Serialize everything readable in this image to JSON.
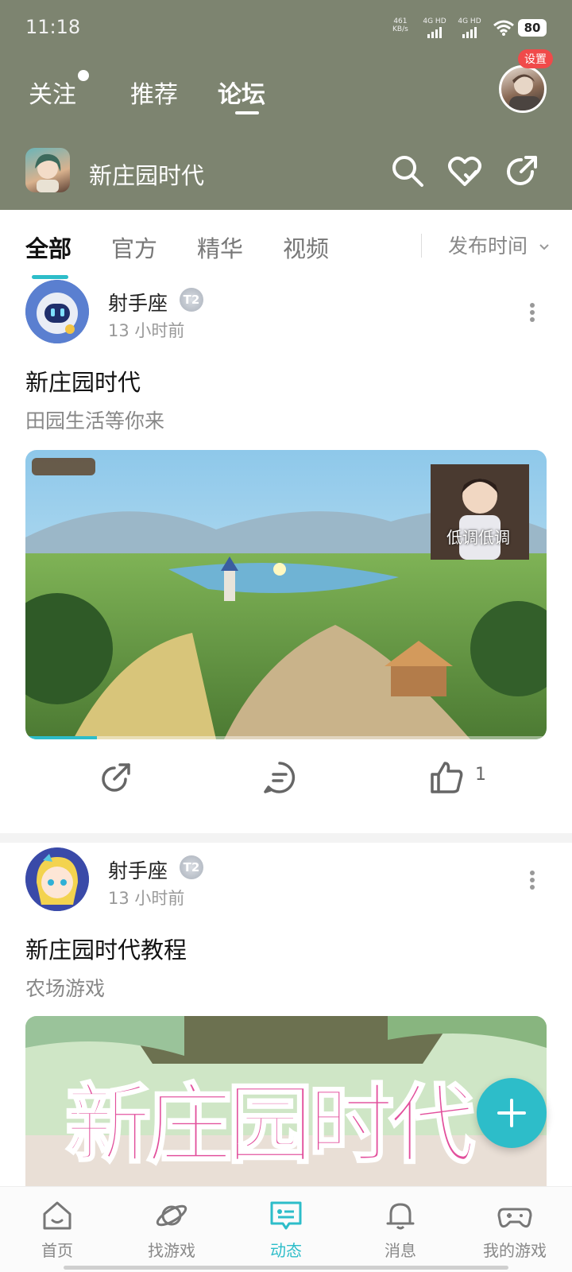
{
  "status_bar": {
    "time": "11:18",
    "net_speed": "461",
    "net_unit": "KB/s",
    "sim1": "4G HD",
    "sim2": "4G HD",
    "battery": "80"
  },
  "top_tabs": {
    "follow": "关注",
    "recommend": "推荐",
    "forum": "论坛",
    "settings_badge": "设置",
    "active": "forum"
  },
  "forum": {
    "title": "新庄园时代",
    "icons": [
      "search-icon",
      "heart-icon",
      "share-icon"
    ]
  },
  "filter_tabs": {
    "all": "全部",
    "official": "官方",
    "featured": "精华",
    "video": "视频",
    "sort": "发布时间"
  },
  "posts": [
    {
      "author": "射手座",
      "level": "T2",
      "time": "13 小时前",
      "title": "新庄园时代",
      "subtitle": "田园生活等你来",
      "overlay_caption": "低调低调",
      "video_progress": 0.14,
      "like_count": "1"
    },
    {
      "author": "射手座",
      "level": "T2",
      "time": "13 小时前",
      "title": "新庄园时代教程",
      "subtitle": "农场游戏",
      "banner_text": "新庄园时代"
    }
  ],
  "bottom_nav": {
    "home": "首页",
    "find": "找游戏",
    "feed": "动态",
    "messages": "消息",
    "mygames": "我的游戏",
    "active": "feed"
  },
  "colors": {
    "header_bg": "#7d8470",
    "accent": "#2dbdc9",
    "badge": "#f04a4a"
  }
}
